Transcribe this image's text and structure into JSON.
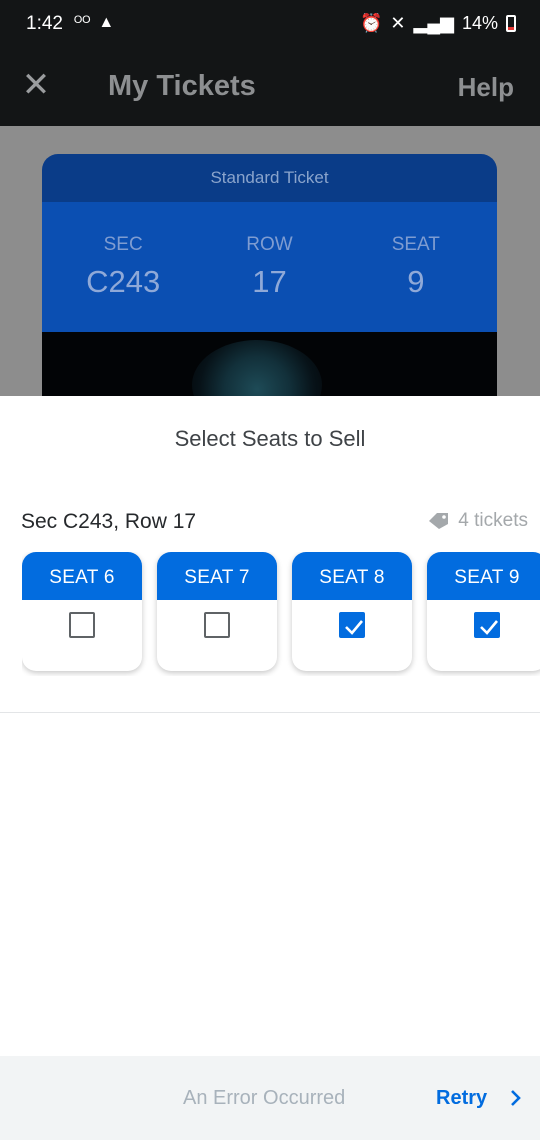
{
  "status_bar": {
    "time": "1:42",
    "battery": "14%"
  },
  "header": {
    "title": "My Tickets",
    "help_label": "Help",
    "close_icon": "close-icon"
  },
  "ticket": {
    "type": "Standard Ticket",
    "sec_label": "SEC",
    "sec_value": "C243",
    "row_label": "ROW",
    "row_value": "17",
    "seat_label": "SEAT",
    "seat_value": "9"
  },
  "sheet": {
    "title": "Select Seats to Sell",
    "section_label": "Sec C243, Row 17",
    "tickets_count": "4 tickets",
    "seats": [
      {
        "label": "SEAT 6",
        "checked": false
      },
      {
        "label": "SEAT 7",
        "checked": false
      },
      {
        "label": "SEAT 8",
        "checked": true
      },
      {
        "label": "SEAT 9",
        "checked": true
      }
    ]
  },
  "footer": {
    "error_text": "An Error Occurred",
    "retry_label": "Retry"
  },
  "colors": {
    "accent": "#026cdf",
    "status_bar": "#131516",
    "footer_bg": "#f2f4f5"
  }
}
